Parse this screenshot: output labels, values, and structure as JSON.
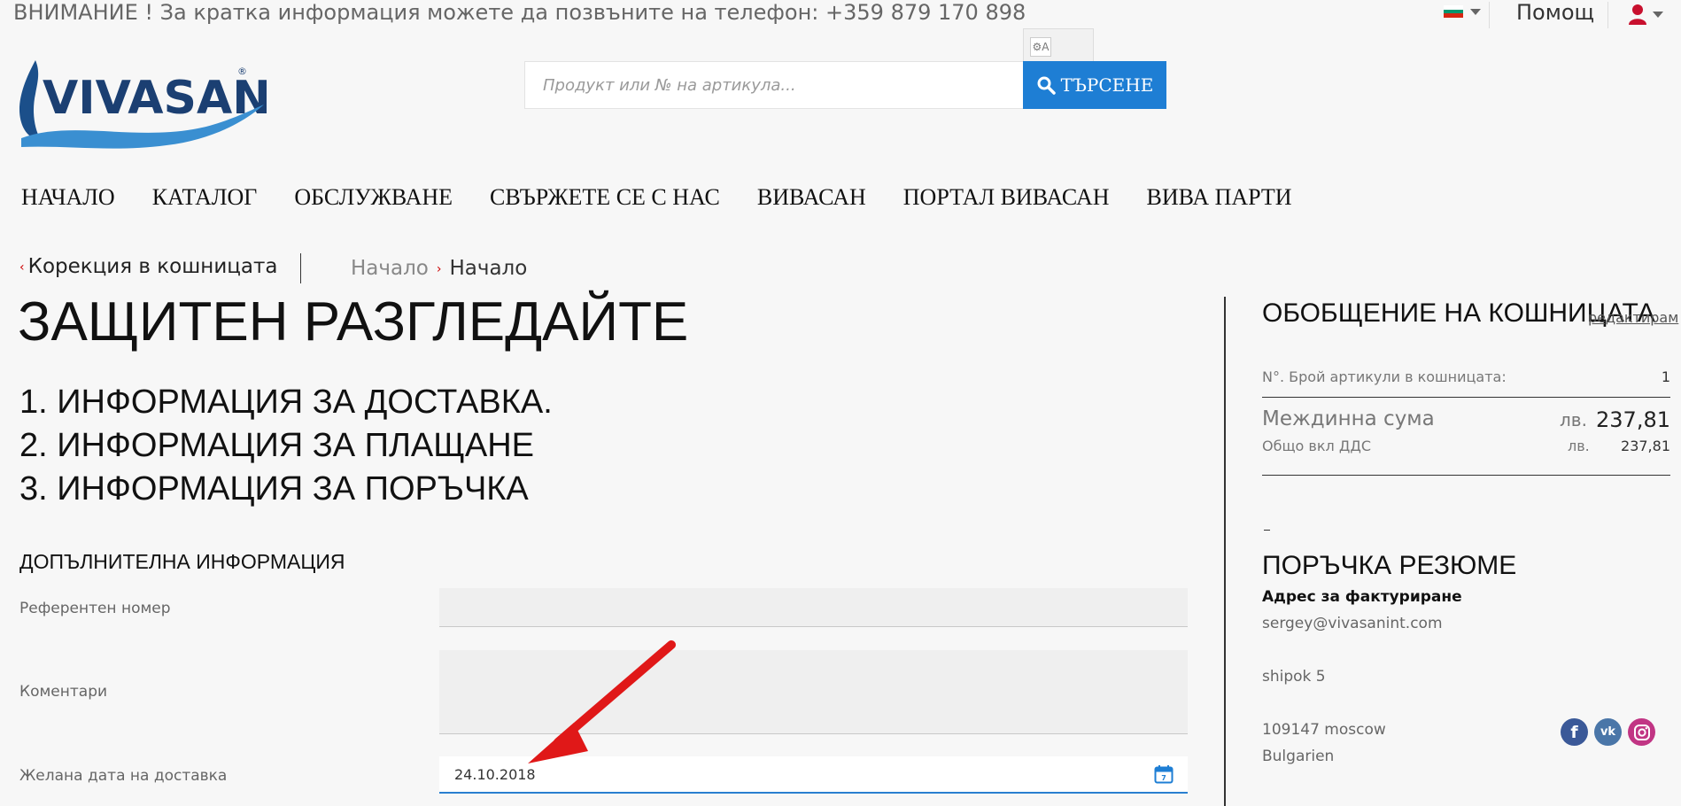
{
  "topbar": {
    "announcement": "ВНИМАНИЕ ! За кратка информация можете да позвъните на телефон: +359 879 170 898",
    "help_label": "Помощ"
  },
  "header": {
    "logo_text": "VIVASAN",
    "search": {
      "placeholder": "Продукт или № на артикула...",
      "button_label": "ТЪРСЕНЕ"
    }
  },
  "nav": {
    "items": [
      {
        "label": "НАЧАЛО"
      },
      {
        "label": "КАТАЛОГ"
      },
      {
        "label": "ОБСЛУЖВАНЕ"
      },
      {
        "label": "СВЪРЖЕТЕ СЕ С НАС"
      },
      {
        "label": "ВИВАСАН"
      },
      {
        "label": "ПОРТАЛ ВИВАСАН"
      },
      {
        "label": "ВИВА ПАРТИ"
      }
    ]
  },
  "breadcrumb": {
    "back_label": "Корекция в кошницата",
    "crumbs": [
      {
        "label": "Начало"
      },
      {
        "label": "Начало"
      }
    ]
  },
  "main": {
    "title": "ЗАЩИТЕН РАЗГЛЕДАЙТЕ",
    "steps": [
      {
        "label": "1. ИНФОРМАЦИЯ ЗА ДОСТАВКА."
      },
      {
        "label": "2. ИНФОРМАЦИЯ ЗА ПЛАЩАНЕ"
      },
      {
        "label": "3. ИНФОРМАЦИЯ ЗА ПОРЪЧКА"
      }
    ],
    "additional_title": "ДОПЪЛНИТЕЛНА ИНФОРМАЦИЯ",
    "fields": {
      "reference": {
        "label": "Референтен номер",
        "value": ""
      },
      "comments": {
        "label": "Коментари",
        "value": ""
      },
      "delivery_date": {
        "label": "Желана дата на доставка",
        "value": "24.10.2018"
      }
    }
  },
  "summary": {
    "title": "ОБОБЩЕНИЕ НА КОШНИЦАТА",
    "edit_label": "редактирам",
    "item_count_label": "N°. Брой артикули в кошницата:",
    "item_count": "1",
    "subtotal_label": "Междинна сума",
    "subtotal_currency": "лв.",
    "subtotal_value": "237,81",
    "total_label": "Общо вкл ДДС",
    "total_currency": "лв.",
    "total_value": "237,81"
  },
  "order": {
    "title": "ПОРЪЧКА РЕЗЮМЕ",
    "billing_heading": "Адрес за фактуриране",
    "email": "sergey@vivasanint.com",
    "street": "shipok 5",
    "city": "109147 moscow",
    "country": "Bulgarien"
  },
  "theme": {
    "accent": "#1e7ed4",
    "arrow": "#e01818",
    "facebook": "#3b5998",
    "vk": "#4a76a8",
    "instagram": "#c13584"
  }
}
